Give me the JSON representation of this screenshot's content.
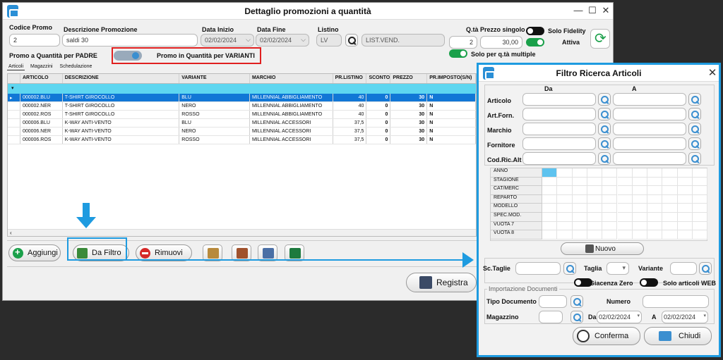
{
  "main_window": {
    "title": "Dettaglio promozioni a quantità",
    "codice_label": "Codice Promo",
    "codice_value": "2",
    "descrizione_label": "Descrizione Promozione",
    "descrizione_value": "saldi 30",
    "data_inizio_label": "Data Inizio",
    "data_inizio_value": "02/02/2024",
    "data_fine_label": "Data Fine",
    "data_fine_value": "02/02/2024",
    "listino_label": "Listino",
    "listino_code": "LV",
    "listino_desc": "LIST.VEND.",
    "qta_label": "Q.tà",
    "qta_value": "2",
    "prezzo_label": "Prezzo singolo",
    "prezzo_value": "30,00",
    "solo_fidelity_label": "Solo Fidelity",
    "attiva_label": "Attiva",
    "promo_padre_label": "Promo a Quantità per PADRE",
    "promo_varianti_label": "Promo in Quantità per VARIANTI",
    "solo_multiple_label": "Solo per q.tà multiple",
    "tabs": [
      "Articoli",
      "Magazzini",
      "Schedulazione"
    ],
    "columns": [
      "ARTICOLO",
      "DESCRIZIONE",
      "VARIANTE",
      "MARCHIO",
      "PR.LISTINO",
      "SCONTO",
      "PREZZO",
      "PR.IMPOSTO(S/N)"
    ],
    "rows": [
      [
        "000002.BLU",
        "T-SHIRT GIROCOLLO",
        "BLU",
        "MILLENNIAL ABBIGLIAMENTO",
        "40",
        "0",
        "30",
        "N"
      ],
      [
        "000002.NER",
        "T-SHIRT GIROCOLLO",
        "NERO",
        "MILLENNIAL ABBIGLIAMENTO",
        "40",
        "0",
        "30",
        "N"
      ],
      [
        "000002.ROS",
        "T-SHIRT GIROCOLLO",
        "ROSSO",
        "MILLENNIAL ABBIGLIAMENTO",
        "40",
        "0",
        "30",
        "N"
      ],
      [
        "000006.BLU",
        "K-WAY ANTI-VENTO",
        "BLU",
        "MILLENNIAL ACCESSORI",
        "37,5",
        "0",
        "30",
        "N"
      ],
      [
        "000006.NER",
        "K-WAY ANTI-VENTO",
        "NERO",
        "MILLENNIAL ACCESSORI",
        "37,5",
        "0",
        "30",
        "N"
      ],
      [
        "000006.ROS",
        "K-WAY ANTI-VENTO",
        "ROSSO",
        "MILLENNIAL ACCESSORI",
        "37,5",
        "0",
        "30",
        "N"
      ]
    ],
    "btn_aggiungi": "Aggiungi",
    "btn_da_filtro": "Da Filtro",
    "btn_rimuovi": "Rimuovi",
    "btn_registra": "Registra"
  },
  "dialog": {
    "title": "Filtro Ricerca Articoli",
    "col_da": "Da",
    "col_a": "A",
    "fields": [
      "Articolo",
      "Art.Forn.",
      "Marchio",
      "Fornitore",
      "Cod.Ric.Alt"
    ],
    "attributes": [
      "ANNO",
      "STAGIONE",
      "CAT/MERC",
      "REPARTO",
      "MODELLO",
      "SPEC.MOD.",
      "VUOTA 7",
      "VUOTA 8"
    ],
    "btn_nuovo": "Nuovo",
    "sc_taglie_label": "Sc.Taglie",
    "taglia_label": "Taglia",
    "variante_label": "Variante",
    "giacenza_label": "Giacenza Zero",
    "solo_web_label": "Solo articoli WEB",
    "importazione_label": "Importazione Documenti",
    "tipo_doc_label": "Tipo Documento",
    "numero_label": "Numero",
    "magazzino_label": "Magazzino",
    "da_label": "Da",
    "da_value": "02/02/2024",
    "a_label": "A",
    "a_value": "02/02/2024",
    "btn_conferma": "Conferma",
    "btn_chiudi": "Chiudi"
  },
  "colors": {
    "accent": "#1e9be0",
    "selected_row": "#1177d6",
    "highlight_box": "#e02020",
    "green": "#1aa04a"
  }
}
